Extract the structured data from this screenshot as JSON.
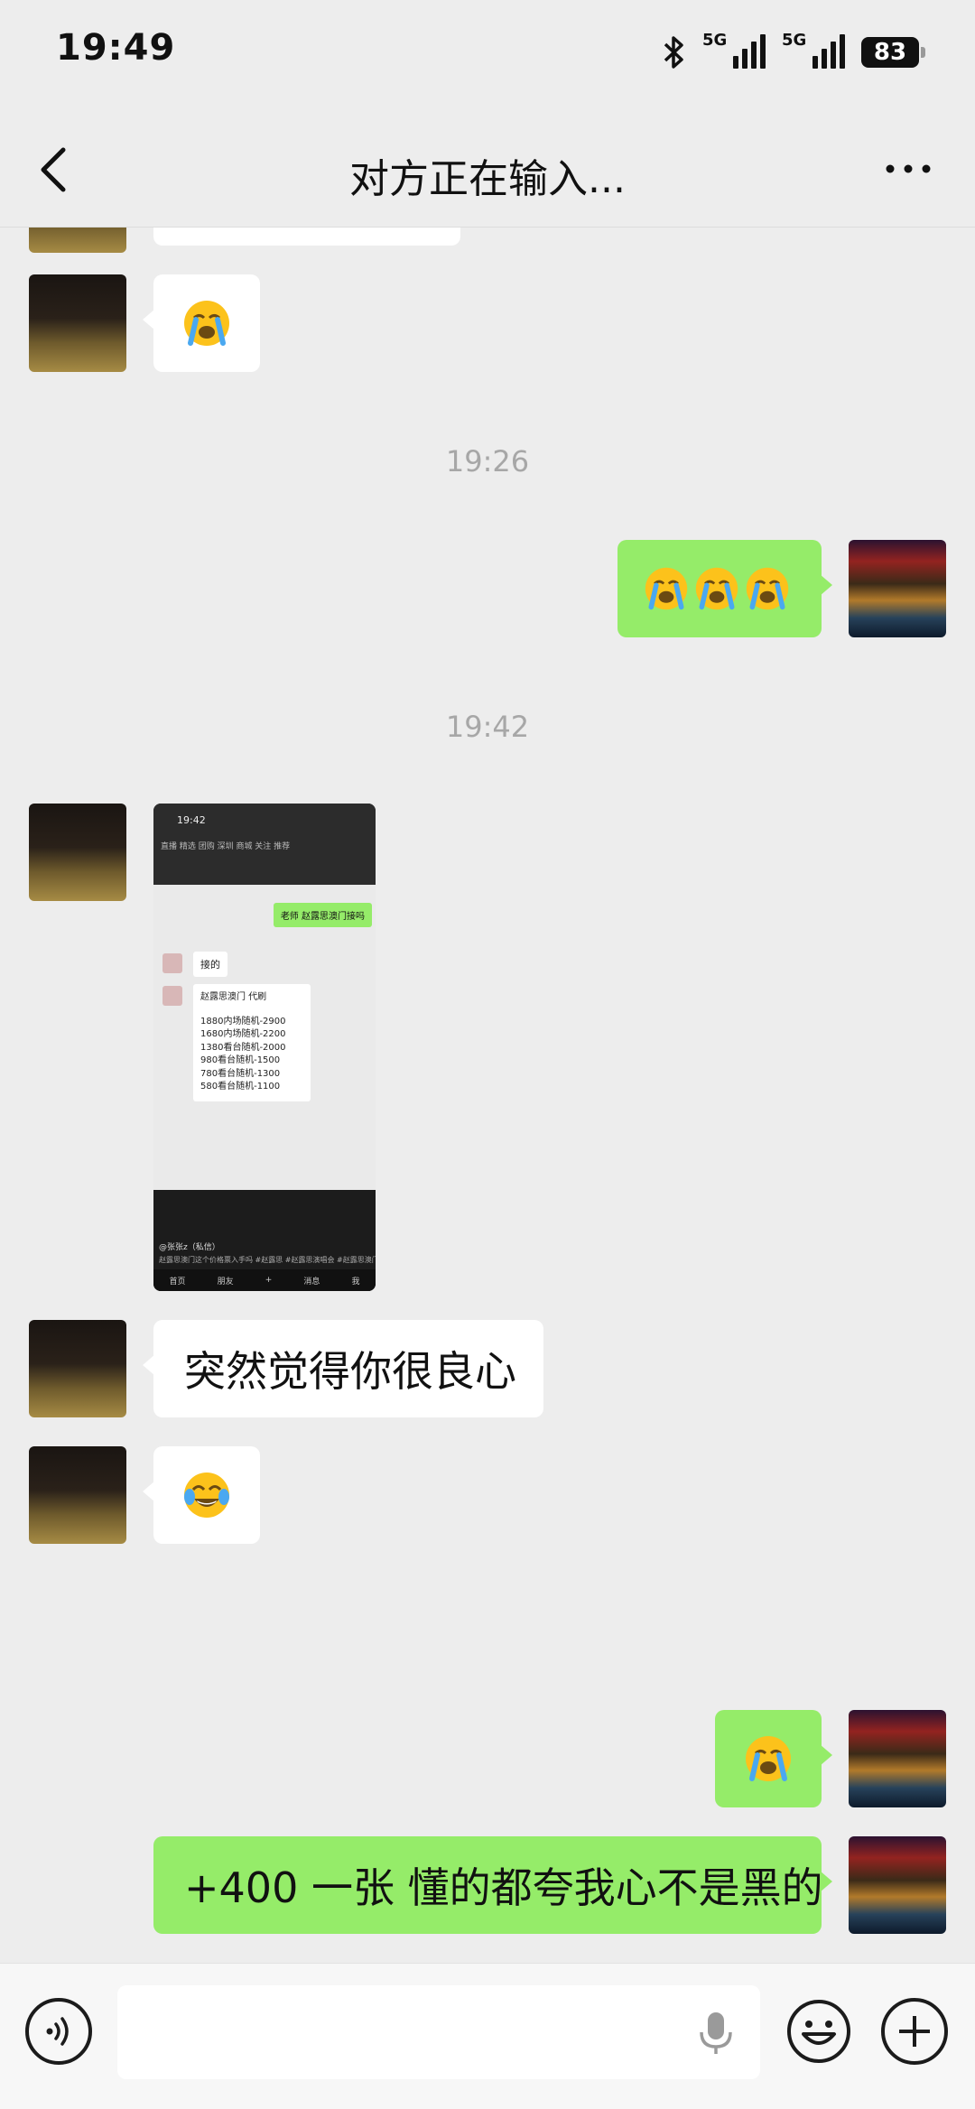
{
  "status_bar": {
    "time": "19:49",
    "signal_1_label": "5G",
    "signal_2_label": "5G",
    "battery": "83",
    "icons": [
      "bluetooth-icon",
      "signal-icon",
      "signal-icon",
      "battery-icon"
    ]
  },
  "nav": {
    "title": "对方正在输入...",
    "icons": [
      "back-chevron-icon",
      "more-dots-icon"
    ]
  },
  "chat": {
    "timestamps": [
      "19:26",
      "19:42"
    ],
    "messages": [
      {
        "from": "other",
        "type": "text",
        "text": ""
      },
      {
        "from": "other",
        "type": "emoji",
        "emoji": "loudly-crying-emoji"
      },
      {
        "from": "me",
        "type": "emoji",
        "emoji": "loudly-crying-emoji",
        "count": 3
      },
      {
        "from": "other",
        "type": "image",
        "image": {
          "time": "19:42",
          "tabs_text": "直播  精选  团购  深圳  商城  关注  推荐",
          "green_bubble": "老师 赵露思澳门接吗",
          "reply1": "接的",
          "reply2_title": "赵露思澳门 代刷",
          "price_lines": [
            "1880内场随机-2900",
            "1680内场随机-2200",
            "1380看台随机-2000",
            "980看台随机-1500",
            "780看台随机-1300",
            "580看台随机-1100"
          ],
          "username": "@张张z（私信）",
          "caption": "赵露思澳门这个价格票入手吗 #赵露思 #赵露思演唱会 #赵露思澳门",
          "bottom_tabs": [
            "首页",
            "朋友",
            "+",
            "消息",
            "我"
          ]
        }
      },
      {
        "from": "other",
        "type": "text",
        "text": "突然觉得你很良心"
      },
      {
        "from": "other",
        "type": "emoji",
        "emoji": "tears-of-joy-emoji"
      },
      {
        "from": "me",
        "type": "emoji",
        "emoji": "loudly-crying-emoji"
      },
      {
        "from": "me",
        "type": "text",
        "text": "+400 一张 懂的都夸我心不是黑的"
      }
    ]
  },
  "input_bar": {
    "placeholder": "",
    "icons": [
      "voice-icon",
      "microphone-icon",
      "emoji-icon",
      "plus-icon"
    ]
  },
  "colors": {
    "background": "#ededed",
    "bubble_out": "#95ec69",
    "bubble_in": "#ffffff",
    "timestamp": "#a7a7a7"
  }
}
